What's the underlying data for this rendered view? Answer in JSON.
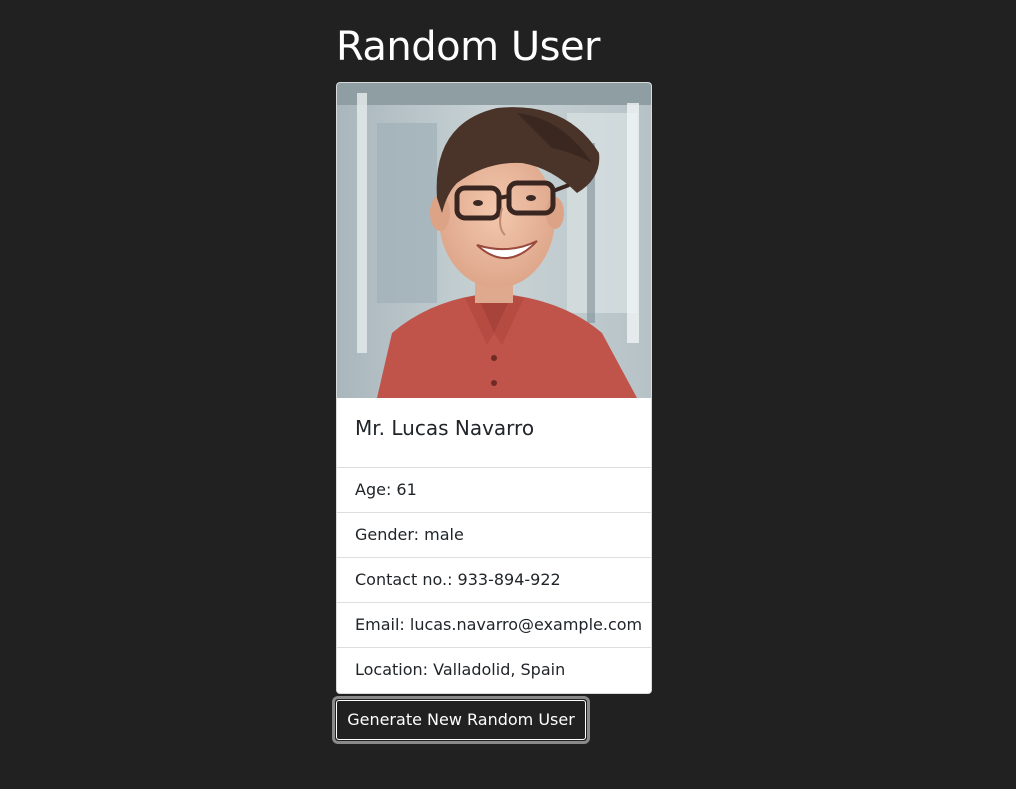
{
  "header": {
    "title": "Random User"
  },
  "user": {
    "name": "Mr. Lucas Navarro",
    "age": "Age: 61",
    "gender": "Gender: male",
    "contact": "Contact no.: 933-894-922",
    "email": "Email: lucas.navarro@example.com",
    "location": "Location: Valladolid, Spain"
  },
  "actions": {
    "generate_label": "Generate New Random User"
  },
  "colors": {
    "background": "#212121",
    "card": "#ffffff",
    "text_dark": "#212529",
    "shirt": "#c0534a"
  }
}
